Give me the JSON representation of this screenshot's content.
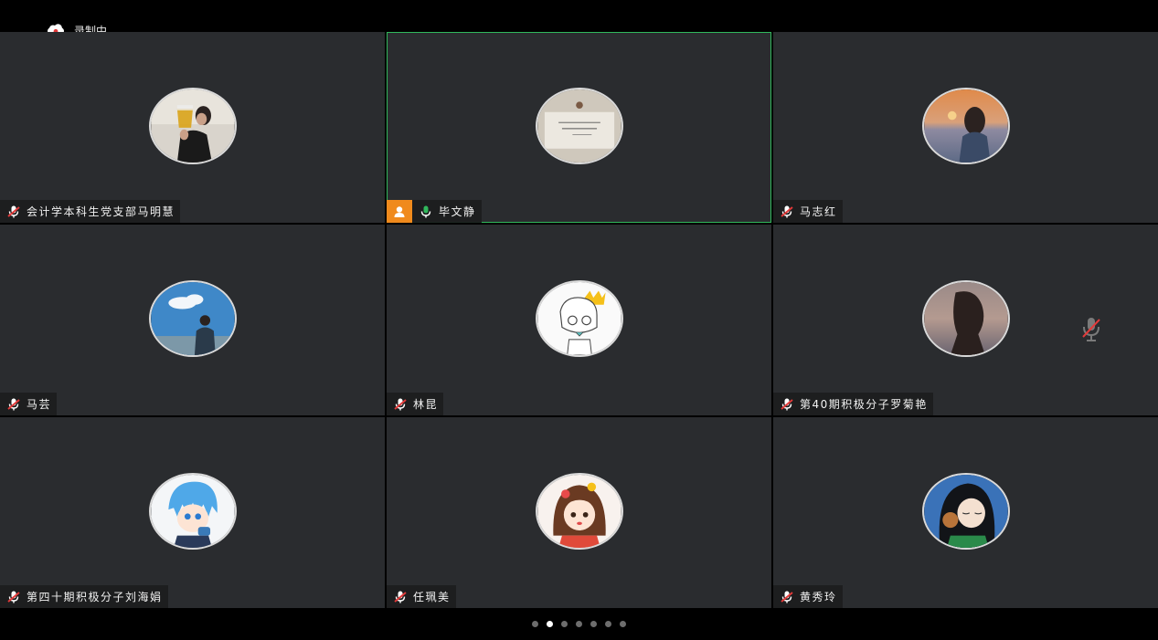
{
  "recording": {
    "label": "录制中",
    "icon": "cloud-record-icon"
  },
  "colors": {
    "tile_bg": "#2a2c2f",
    "active_border": "#31b85c",
    "host_badge": "#f08a1c",
    "mic_muted": "#e23a3a",
    "mic_active": "#31b85c"
  },
  "participants": [
    {
      "name": "会计学本科生党支部马明慧",
      "mic": "muted",
      "avatar": "person-drinking-avatar",
      "active": false,
      "host": false
    },
    {
      "name": "毕文静",
      "mic": "active",
      "avatar": "handwritten-card-avatar",
      "active": true,
      "host": true
    },
    {
      "name": "马志红",
      "mic": "muted",
      "avatar": "sunset-girl-avatar",
      "active": false,
      "host": false
    },
    {
      "name": "马芸",
      "mic": "muted",
      "avatar": "sky-person-avatar",
      "active": false,
      "host": false
    },
    {
      "name": "林昆",
      "mic": "muted",
      "avatar": "cartoon-crown-boy-avatar",
      "active": false,
      "host": false
    },
    {
      "name": "第40期积极分子罗菊艳",
      "mic": "muted",
      "avatar": "silhouette-girl-avatar",
      "active": false,
      "host": false,
      "tile_mic_muted": true
    },
    {
      "name": "第四十期积极分子刘海娟",
      "mic": "muted",
      "avatar": "anime-blue-hair-avatar",
      "active": false,
      "host": false
    },
    {
      "name": "任珮美",
      "mic": "muted",
      "avatar": "cartoon-girl-avatar",
      "active": false,
      "host": false
    },
    {
      "name": "黄秀玲",
      "mic": "muted",
      "avatar": "anime-dark-hair-avatar",
      "active": false,
      "host": false
    }
  ],
  "pagination": {
    "pages": 7,
    "current": 2
  }
}
